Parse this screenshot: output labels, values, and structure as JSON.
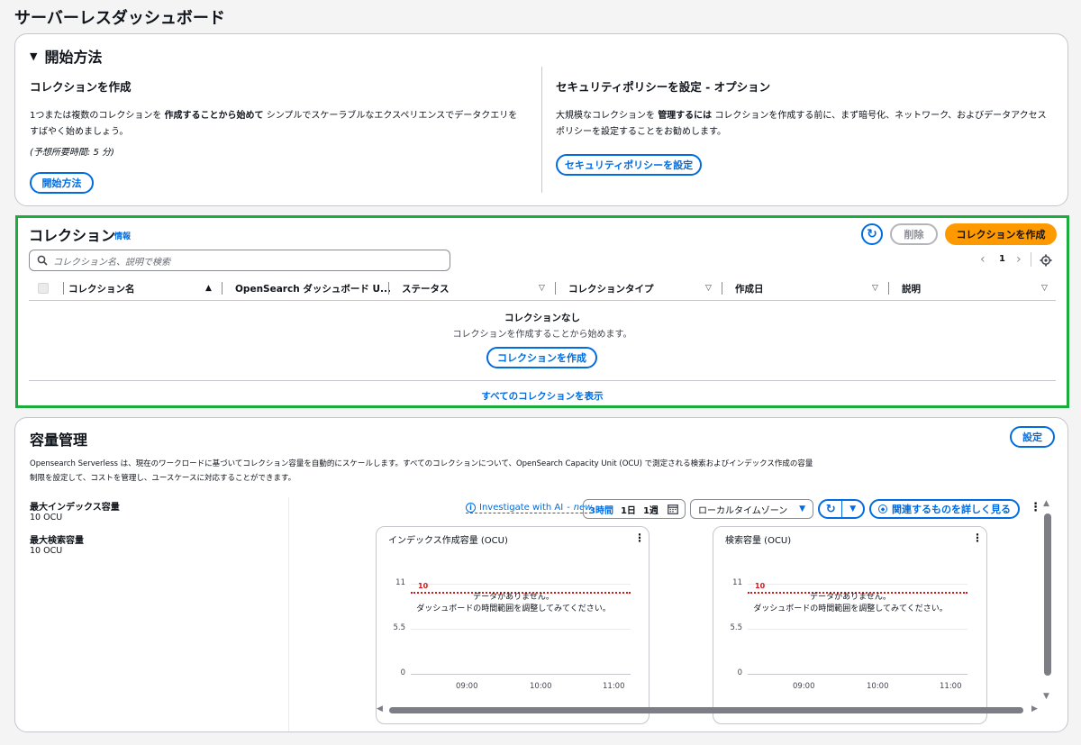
{
  "page": {
    "title": "サーバーレスダッシュボード"
  },
  "get_started": {
    "header": "開始方法",
    "create": {
      "title": "コレクションを作成",
      "text_pre": "1つまたは複数のコレクションを ",
      "text_bold": "作成することから始めて",
      "text_post": " シンプルでスケーラブルなエクスペリエンスでデータクエリを",
      "text_line2": "すばやく始めましょう。",
      "estimate": "(予想所要時間: 5 分)",
      "button": "開始方法"
    },
    "security": {
      "title": "セキュリティポリシーを設定 - オプション",
      "text_pre": "大規模なコレクションを ",
      "text_bold": "管理するには",
      "text_post": " コレクションを作成する前に、まず暗号化、ネットワーク、およびデータアクセス",
      "text_line2": "ポリシーを設定することをお勧めします。",
      "button": "セキュリティポリシーを設定"
    }
  },
  "collections": {
    "title": "コレクション",
    "info": "情報",
    "delete_button": "削除",
    "create_button": "コレクションを作成",
    "search_placeholder": "コレクション名、説明で検索",
    "page_number": "1",
    "columns": [
      "コレクション名",
      "OpenSearch ダッシュボード U...",
      "ステータス",
      "コレクションタイプ",
      "作成日",
      "説明"
    ],
    "empty_title": "コレクションなし",
    "empty_text": "コレクションを作成することから始めます。",
    "empty_button": "コレクションを作成",
    "view_all": "すべてのコレクションを表示"
  },
  "capacity": {
    "title": "容量管理",
    "settings_button": "設定",
    "description_line1": "Opensearch Serverless は、現在のワークロードに基づいてコレクション容量を自動的にスケールします。すべてのコレクションについて、OpenSearch Capacity Unit (OCU) で測定される検索およびインデックス作成の容量",
    "description_line2": "制限を設定して、コストを管理し、ユースケースに対応することができます。",
    "max_index_label": "最大インデックス容量",
    "max_index_value": "10 OCU",
    "max_search_label": "最大検索容量",
    "max_search_value": "10 OCU",
    "investigate_text": "Investigate with AI",
    "investigate_new": "new",
    "time_ranges": [
      "3時間",
      "1日",
      "1週"
    ],
    "timezone": "ローカルタイムゾーン",
    "explore_button": "関連するものを詳しく見る"
  },
  "charts": {
    "no_data_line1": "データがありません。",
    "no_data_line2": "ダッシュボードの時間範囲を調整してみてください。",
    "items": [
      {
        "title": "インデックス作成容量 (OCU)"
      },
      {
        "title": "検索容量 (OCU)"
      }
    ]
  },
  "chart_data": [
    {
      "type": "line",
      "title": "インデックス作成容量 (OCU)",
      "x_ticks": [
        "09:00",
        "10:00",
        "11:00"
      ],
      "y_ticks": [
        "11",
        "5.5",
        "0"
      ],
      "ylim": [
        0,
        11
      ],
      "series": [],
      "threshold": {
        "value": 10,
        "label": "10",
        "color": "#d91515"
      }
    },
    {
      "type": "line",
      "title": "検索容量 (OCU)",
      "x_ticks": [
        "09:00",
        "10:00",
        "11:00"
      ],
      "y_ticks": [
        "11",
        "5.5",
        "0"
      ],
      "ylim": [
        0,
        11
      ],
      "series": [],
      "threshold": {
        "value": 10,
        "label": "10",
        "color": "#d91515"
      }
    }
  ],
  "colors": {
    "accent": "#006ce0",
    "primary": "#ff9900",
    "highlight": "#1aad3b",
    "threshold": "#d91515"
  }
}
